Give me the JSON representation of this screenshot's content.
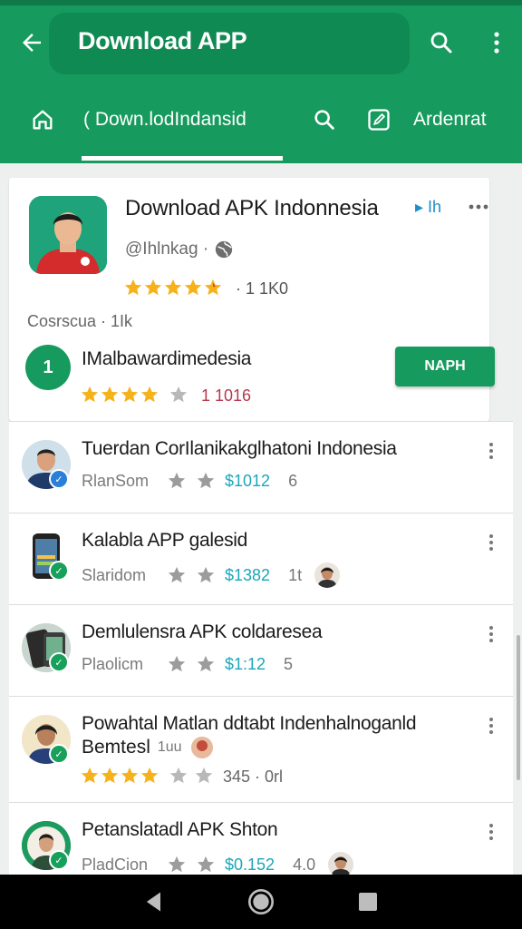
{
  "appbar": {
    "title": "Download APP",
    "back_icon": "arrow-left-icon",
    "search_icon": "search-icon",
    "more_icon": "more-vert-icon",
    "color": "#169a5d"
  },
  "tabs": [
    {
      "label": "",
      "icon": "home-icon"
    },
    {
      "label": "( Down.lodIndansid",
      "icon": "",
      "active": true
    },
    {
      "label": "",
      "icon": "search-icon"
    },
    {
      "label": "",
      "icon": "edit-icon"
    },
    {
      "label": "Ardenrat",
      "icon": ""
    }
  ],
  "featured": {
    "title": "Download APK Indonnesia",
    "lang": "▸ Ih",
    "developer": "@Ihlnkag ·",
    "rating": 4.5,
    "rating_count": "· 1 1K0",
    "size": "Cosrscua · 1Ik",
    "rank": "1",
    "sub_title": "IMalbawardimedesia",
    "sub_rating": 4,
    "sub_count": "1 1016",
    "install_label": "NAPH"
  },
  "list": [
    {
      "title": "Tuerdan CorIlanikakglhatoni Indonesia",
      "developer": "RlanSom",
      "price": "$1012",
      "extra": "6",
      "badge": "blue"
    },
    {
      "title": "Kalabla APP galesid",
      "developer": "Slaridom",
      "price": "$1382",
      "extra": "1t",
      "badge": "green",
      "avatar": true
    },
    {
      "title": "Demlulensra APK coldaresea",
      "developer": "Plaolicm",
      "price": "$1:12",
      "extra": "5",
      "badge": "green"
    },
    {
      "title": "Powahtal Matlan ddtabt Indenhalnoganld",
      "title2": "Bemtesl",
      "title2_suffix": "1uu",
      "rating": 4,
      "count": "345 · 0rl",
      "badge": "green"
    },
    {
      "title": "Petanslatadl APK Shton",
      "developer": "PladCion",
      "price": "$0.152",
      "extra": "4.0",
      "badge": "green",
      "avatar": true
    }
  ],
  "colors": {
    "accent": "#169a5d",
    "star": "#f6b21b",
    "price": "#1aa7b8"
  }
}
